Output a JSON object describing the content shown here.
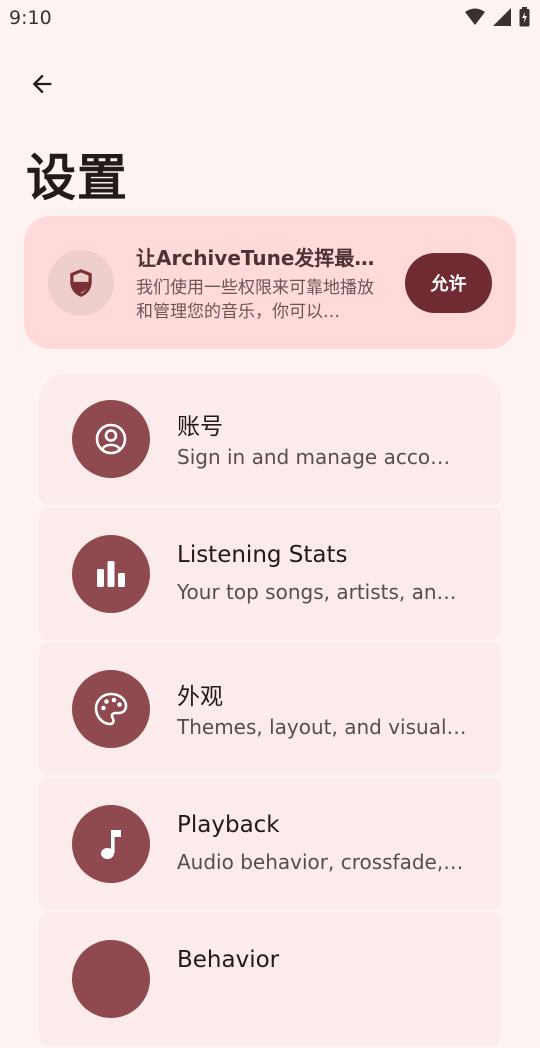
{
  "status_bar": {
    "time": "9:10"
  },
  "page": {
    "title": "设置"
  },
  "permission_card": {
    "title": "让ArchiveTune发挥最佳…",
    "description": "我们使用一些权限来可靠地播放和管理您的音乐，你可以…",
    "allow_label": "允许"
  },
  "settings": {
    "items": [
      {
        "icon": "account-icon",
        "title": "账号",
        "subtitle": "Sign in and manage acco…"
      },
      {
        "icon": "bar-chart-icon",
        "title": "Listening Stats",
        "subtitle": "Your top songs, artists, an…"
      },
      {
        "icon": "palette-icon",
        "title": "外观",
        "subtitle": "Themes, layout, and visual…"
      },
      {
        "icon": "music-note-icon",
        "title": "Playback",
        "subtitle": "Audio behavior, crossfade,…"
      },
      {
        "icon": "behavior-icon",
        "title": "Behavior",
        "subtitle": ""
      }
    ]
  },
  "colors": {
    "background": "#fdf4f2",
    "permission_card": "#ffdad8",
    "allow_button": "#6f2b31",
    "icon_circle": "#8f4a4f",
    "list_item": "#fbeceb"
  }
}
